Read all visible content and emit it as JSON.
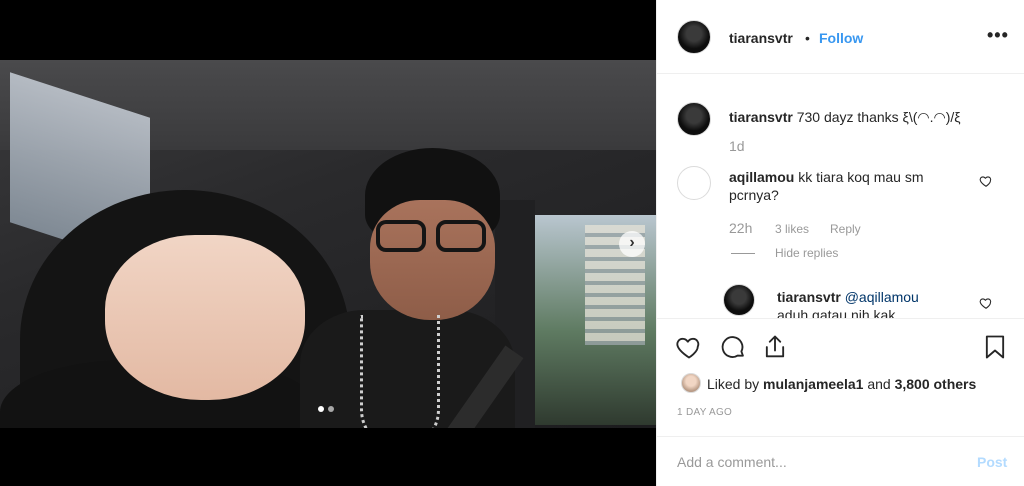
{
  "header": {
    "username": "tiaransvtr",
    "separator": "•",
    "follow_label": "Follow",
    "more_label": "•••"
  },
  "media": {
    "next_icon": "›",
    "carousel": {
      "total": 2,
      "active": 1
    }
  },
  "comments": [
    {
      "username": "tiaransvtr",
      "text": "730 dayz thanks ξ\\(◠.◠)/ξ",
      "time": "1d"
    },
    {
      "username": "aqillamou",
      "text_line1": "kk tiara koq mau sm",
      "text_line2": "pcrnya?",
      "time": "22h",
      "likes": "3 likes",
      "reply_label": "Reply",
      "hide_replies": "Hide replies"
    },
    {
      "username": "tiaransvtr",
      "mention": "@aqillamou",
      "text": "aduh gatau nih kak"
    }
  ],
  "actions": {
    "like_icon": "heart-icon",
    "comment_icon": "comment-icon",
    "share_icon": "share-icon",
    "save_icon": "bookmark-icon",
    "liked_by_prefix": "Liked by",
    "liked_by_user": "mulanjameela1",
    "liked_by_and": "and",
    "liked_by_count": "3,800 others",
    "timestamp": "1 DAY AGO"
  },
  "add_comment": {
    "placeholder": "Add a comment...",
    "post_label": "Post"
  }
}
